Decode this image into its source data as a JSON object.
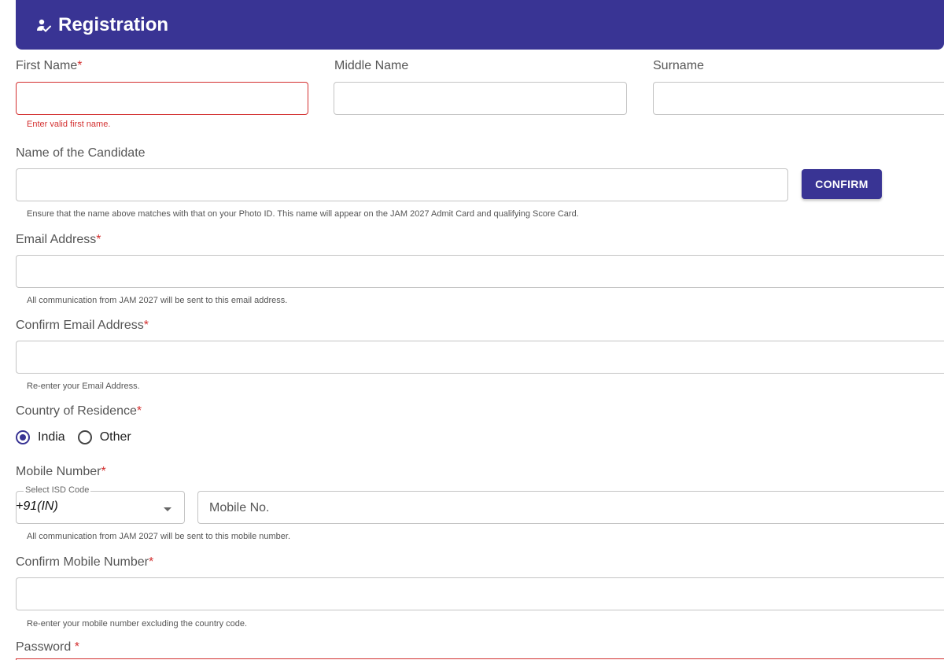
{
  "header": {
    "title": "Registration",
    "icon": "person-check-icon"
  },
  "colors": {
    "brand": "#393494",
    "error": "#d32f2f"
  },
  "fields": {
    "first_name": {
      "label": "First Name",
      "required_mark": "*",
      "value": "",
      "error": "Enter valid first name."
    },
    "middle_name": {
      "label": "Middle Name",
      "value": ""
    },
    "surname": {
      "label": "Surname",
      "value": ""
    },
    "candidate_name": {
      "label": "Name of the Candidate",
      "value": "",
      "helper": "Ensure that the name above matches with that on your Photo ID. This name will appear on the JAM 2027 Admit Card and qualifying Score Card."
    },
    "email": {
      "label": "Email Address",
      "required_mark": "*",
      "value": "",
      "helper": "All communication from JAM 2027 will be sent to this email address."
    },
    "confirm_email": {
      "label": "Confirm Email Address",
      "required_mark": "*",
      "value": "",
      "helper": "Re-enter your Email Address."
    },
    "country": {
      "label": "Country of Residence",
      "required_mark": "*",
      "options": [
        "India",
        "Other"
      ],
      "selected": "India"
    },
    "mobile": {
      "label": "Mobile Number",
      "required_mark": "*",
      "isd_legend": "Select ISD Code",
      "isd_value": "+91(IN)",
      "placeholder": "Mobile No.",
      "helper": "All communication from JAM 2027 will be sent to this mobile number."
    },
    "confirm_mobile": {
      "label": "Confirm Mobile Number",
      "required_mark": "*",
      "value": "",
      "helper": "Re-enter your mobile number excluding the country code."
    },
    "password": {
      "label": "Password ",
      "required_mark": "*"
    }
  },
  "buttons": {
    "confirm": "CONFIRM"
  }
}
